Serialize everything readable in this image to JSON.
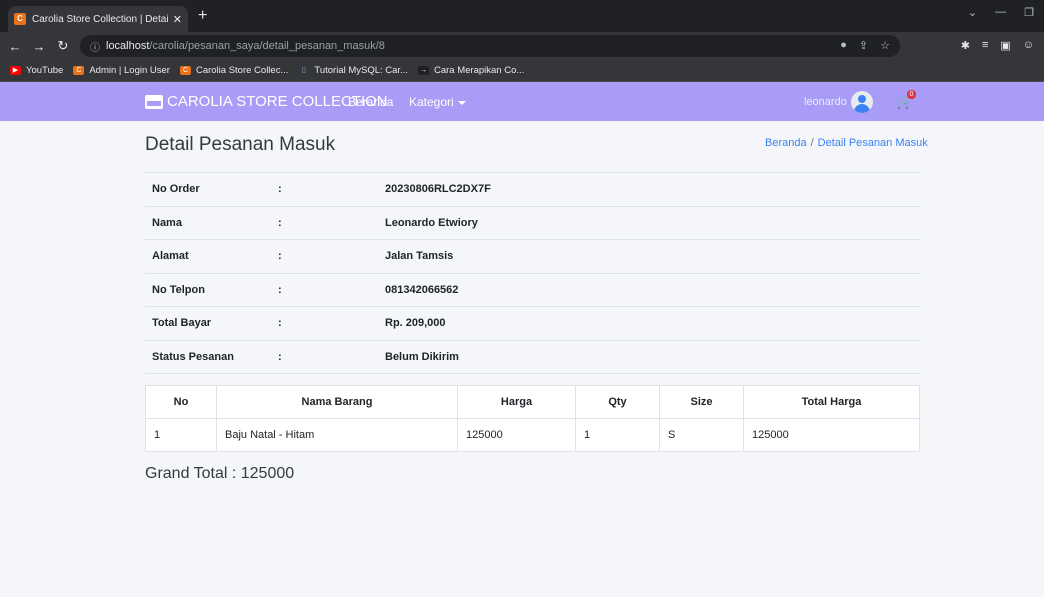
{
  "browser": {
    "tab_title": "Carolia Store Collection | Detail P",
    "url_host": "localhost",
    "url_path": "/carolia/pesanan_saya/detail_pesanan_masuk/8",
    "bookmarks": [
      {
        "label": "YouTube",
        "color": "#ff0000"
      },
      {
        "label": "Admin | Login User",
        "color": "#e8711c"
      },
      {
        "label": "Carolia Store Collec...",
        "color": "#e8711c"
      },
      {
        "label": "Tutorial MySQL: Car...",
        "color": "#1a73e8"
      },
      {
        "label": "Cara Merapikan Co...",
        "color": "#5f6368"
      }
    ]
  },
  "navbar": {
    "brand": "CAROLIA STORE COLLECTION",
    "links": [
      "Beranda",
      "Kategori"
    ],
    "user_name": "leonardo",
    "cart_count": "0",
    "bg_color": "#a89cf6"
  },
  "page": {
    "title": "Detail Pesanan Masuk",
    "breadcrumb": [
      "Beranda",
      "Detail Pesanan Masuk"
    ]
  },
  "order_info": [
    {
      "label": "No Order",
      "sep": ":",
      "value": "20230806RLC2DX7F"
    },
    {
      "label": "Nama",
      "sep": ":",
      "value": "Leonardo Etwiory"
    },
    {
      "label": "Alamat",
      "sep": ":",
      "value": "Jalan Tamsis"
    },
    {
      "label": "No Telpon",
      "sep": ":",
      "value": "081342066562"
    },
    {
      "label": "Total Bayar",
      "sep": ":",
      "value": "Rp. 209,000"
    },
    {
      "label": "Status Pesanan",
      "sep": ":",
      "value": "Belum Dikirim"
    }
  ],
  "items_table": {
    "headers": [
      "No",
      "Nama Barang",
      "Harga",
      "Qty",
      "Size",
      "Total Harga"
    ],
    "rows": [
      [
        "1",
        "Baju Natal - Hitam",
        "125000",
        "1",
        "S",
        "125000"
      ]
    ]
  },
  "grand_total": "Grand Total : 125000"
}
